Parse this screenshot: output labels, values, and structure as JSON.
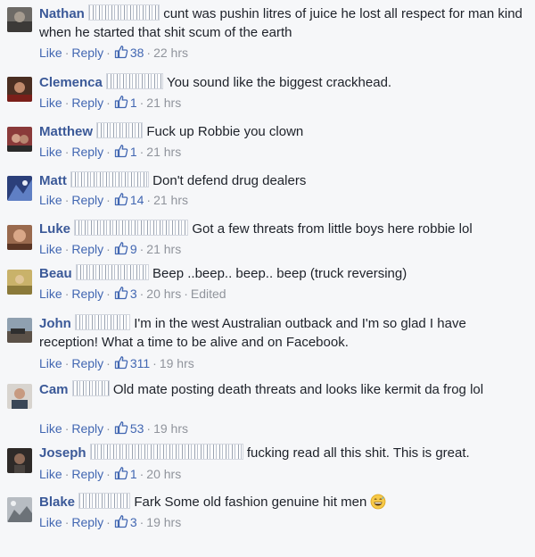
{
  "actions": {
    "like": "Like",
    "reply": "Reply",
    "dot": "·"
  },
  "comments": [
    {
      "name": "Nathan",
      "text": "cunt was pushin litres of juice he lost all respect for man kind when he started that shit scum of the earth",
      "likes": "38",
      "time": "22 hrs",
      "edited": ""
    },
    {
      "name": "Clemenca",
      "text": "You sound like the biggest crackhead.",
      "likes": "1",
      "time": "21 hrs",
      "edited": ""
    },
    {
      "name": "Matthew",
      "text": "Fuck up Robbie you clown",
      "likes": "1",
      "time": "21 hrs",
      "edited": ""
    },
    {
      "name": "Matt",
      "text": "Don't defend drug dealers",
      "likes": "14",
      "time": "21 hrs",
      "edited": ""
    },
    {
      "name": "Luke",
      "text": "Got a few threats from little boys here robbie lol",
      "likes": "9",
      "time": "21 hrs",
      "edited": ""
    },
    {
      "name": "Beau",
      "text": "Beep ..beep.. beep.. beep (truck reversing)",
      "likes": "3",
      "time": "20 hrs",
      "edited": "Edited"
    },
    {
      "name": "John",
      "text": "I'm in the west Australian outback and I'm so glad I have reception! What a time to be alive and on Facebook.",
      "likes": "311",
      "time": "19 hrs",
      "edited": ""
    },
    {
      "name": "Cam",
      "text": "Old mate posting death threats and looks like kermit da frog lol",
      "likes": "53",
      "time": "19 hrs",
      "edited": ""
    },
    {
      "name": "Joseph",
      "text": "fucking read all this shit. This is great.",
      "likes": "1",
      "time": "20 hrs",
      "edited": ""
    },
    {
      "name": "Blake",
      "text": "Fark Some old fashion genuine hit men",
      "likes": "3",
      "time": "19 hrs",
      "edited": ""
    }
  ],
  "colors": {
    "name": "#3b5998",
    "link": "#4267b2",
    "meta": "#90949c",
    "background": "#f6f7f9"
  },
  "icons": {
    "like": "thumbs-up-icon",
    "emoji": "grinning-sweat-emoji-icon"
  }
}
